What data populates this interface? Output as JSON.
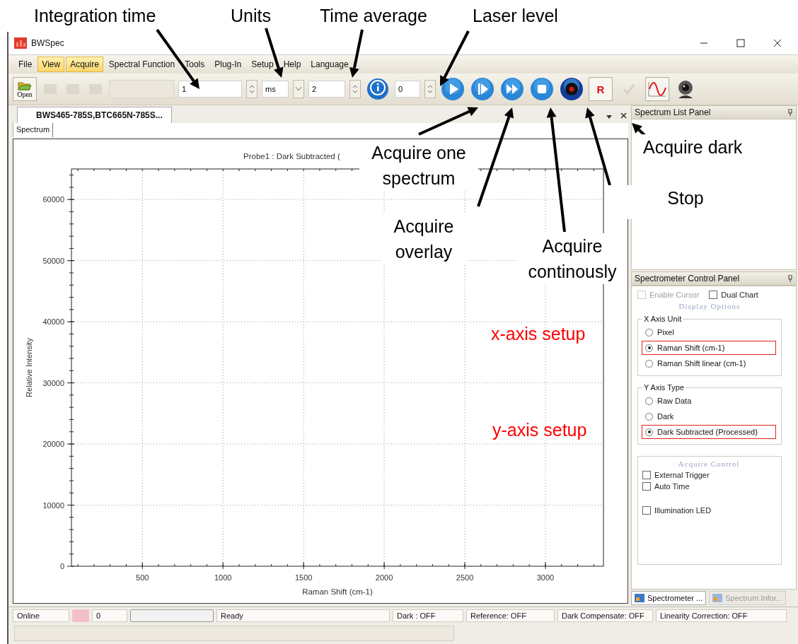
{
  "window": {
    "title": "BWSpec"
  },
  "menu": [
    {
      "label": "File",
      "highlighted": false
    },
    {
      "label": "View",
      "highlighted": true
    },
    {
      "label": "Acquire",
      "highlighted": true
    },
    {
      "label": "Spectral Function",
      "highlighted": false
    },
    {
      "label": "Tools",
      "highlighted": false
    },
    {
      "label": "Plug-In",
      "highlighted": false
    },
    {
      "label": "Setup",
      "highlighted": false
    },
    {
      "label": "Help",
      "highlighted": false
    },
    {
      "label": "Language",
      "highlighted": false
    }
  ],
  "toolbar": {
    "open_label": "Open",
    "integration_time": "1",
    "units": "ms",
    "time_average": "2",
    "laser_level": "0",
    "acquire_buttons": [
      {
        "kind": "play"
      },
      {
        "kind": "overlay"
      },
      {
        "kind": "continuous"
      },
      {
        "kind": "stop"
      },
      {
        "kind": "dark"
      }
    ],
    "chart_tools": [
      {
        "kind": "letter",
        "text": "R"
      },
      {
        "kind": "check",
        "disabled": true
      },
      {
        "kind": "sine"
      },
      {
        "kind": "webcam"
      }
    ]
  },
  "document": {
    "tab": "BWS465-785S,BTC665N-785S...",
    "subtab": "Spectrum",
    "chart_data": {
      "type": "line",
      "grid": true,
      "title": "Probe1 : Dark Subtracted (",
      "xlabel": "Raman Shift (cm-1)",
      "ylabel": "Relative Intensity",
      "xlim": [
        60,
        3360
      ],
      "ylim": [
        0,
        65000
      ],
      "xticks": [
        500,
        1000,
        1500,
        2000,
        2500,
        3000
      ],
      "yticks": [
        0,
        10000,
        20000,
        30000,
        40000,
        50000,
        60000
      ]
    }
  },
  "spectrum_list_panel": {
    "title": "Spectrum List Panel"
  },
  "control_panel": {
    "title": "Spectrometer Control Panel",
    "enable_cursor": {
      "label": "Enable Cursor",
      "checked": false,
      "disabled": true
    },
    "dual_chart": {
      "label": "Dual Chart",
      "checked": false
    },
    "display_heading": "Display Options",
    "x_axis_unit": {
      "title": "X Axis Unit",
      "options": [
        {
          "label": "Pixel",
          "selected": false,
          "highlighted": false
        },
        {
          "label": "Raman Shift (cm-1)",
          "selected": true,
          "highlighted": true
        },
        {
          "label": "Raman Shift linear (cm-1)",
          "selected": false,
          "highlighted": false
        }
      ]
    },
    "y_axis_type": {
      "title": "Y Axis Type",
      "options": [
        {
          "label": "Raw Data",
          "selected": false,
          "highlighted": false
        },
        {
          "label": "Dark",
          "selected": false,
          "highlighted": false
        },
        {
          "label": "Dark Subtracted (Processed)",
          "selected": true,
          "highlighted": true
        }
      ]
    },
    "acquire_control": {
      "heading": "Acquire Control",
      "checkboxes": [
        {
          "label": "External Trigger",
          "checked": false
        },
        {
          "label": "Auto Time",
          "checked": false
        },
        {
          "label": "Illumination LED",
          "checked": false
        }
      ]
    },
    "bottom_tabs": [
      {
        "label": "Spectrometer ...",
        "selected": true
      },
      {
        "label": "Spectrum Infor...",
        "selected": false
      }
    ]
  },
  "status_bar": [
    {
      "kind": "text",
      "text": "Online"
    },
    {
      "kind": "swatch",
      "color": "#f4c0c8"
    },
    {
      "kind": "text",
      "text": "0"
    },
    {
      "kind": "progress",
      "level": 0
    },
    {
      "kind": "text",
      "text": "Ready"
    },
    {
      "kind": "text",
      "text": "Dark : OFF"
    },
    {
      "kind": "text",
      "text": "Reference: OFF"
    },
    {
      "kind": "text",
      "text": "Dark Compensate: OFF"
    },
    {
      "kind": "text",
      "text": "Linearity Correction: OFF"
    }
  ],
  "annotations": [
    {
      "text": "Integration time",
      "color": "#000000"
    },
    {
      "text": "Units",
      "color": "#000000"
    },
    {
      "text": "Time average",
      "color": "#000000"
    },
    {
      "text": "Laser level",
      "color": "#000000"
    },
    {
      "text": "Acquire one spectrum",
      "color": "#000000"
    },
    {
      "text": "Acquire overlay",
      "color": "#000000"
    },
    {
      "text": "Acquire continously",
      "color": "#000000"
    },
    {
      "text": "Stop",
      "color": "#000000"
    },
    {
      "text": "Acquire dark",
      "color": "#000000"
    },
    {
      "text": "x-axis setup",
      "color": "#ff0000"
    },
    {
      "text": "y-axis setup",
      "color": "#ff0000"
    }
  ]
}
